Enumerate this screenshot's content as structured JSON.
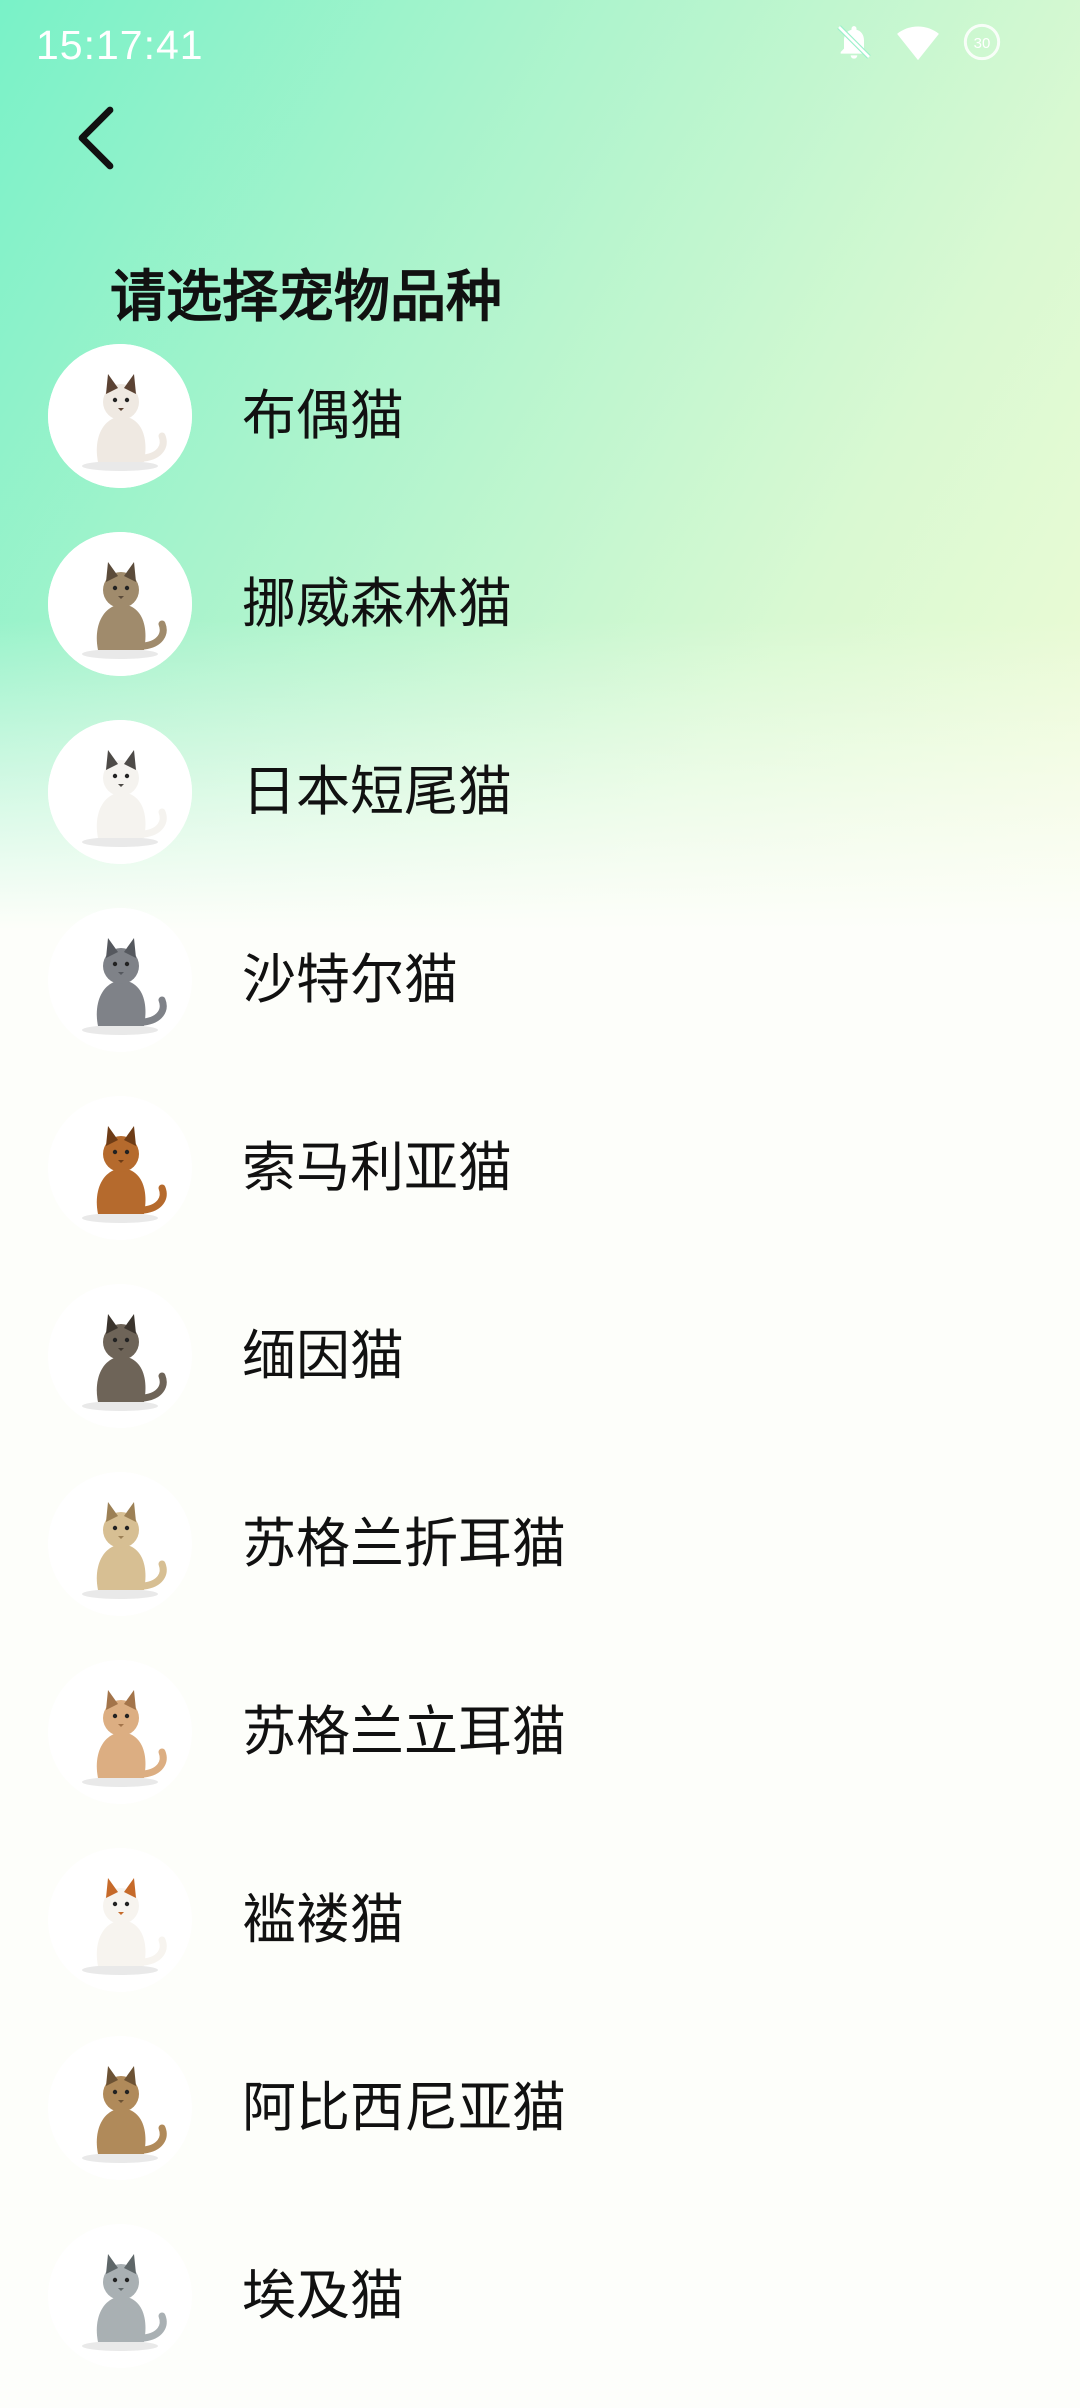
{
  "status_bar": {
    "time": "15:17:41",
    "icons": [
      "bell-off-icon",
      "wifi-icon",
      "data-saver-icon"
    ]
  },
  "header": {
    "back_icon": "chevron-left-icon",
    "title": "请选择宠物品种"
  },
  "breeds": [
    {
      "name": "布偶猫",
      "fur": "#efe9e2",
      "accent": "#5b4233"
    },
    {
      "name": "挪威森林猫",
      "fur": "#a08b6c",
      "accent": "#5b4b3a"
    },
    {
      "name": "日本短尾猫",
      "fur": "#f5f3ef",
      "accent": "#4d4a47"
    },
    {
      "name": "沙特尔猫",
      "fur": "#7f8288",
      "accent": "#55585e"
    },
    {
      "name": "索马利亚猫",
      "fur": "#b56a2d",
      "accent": "#6e3c16"
    },
    {
      "name": "缅因猫",
      "fur": "#6e6458",
      "accent": "#3b342d"
    },
    {
      "name": "苏格兰折耳猫",
      "fur": "#d7bf93",
      "accent": "#9c8055"
    },
    {
      "name": "苏格兰立耳猫",
      "fur": "#dcae82",
      "accent": "#a3744a"
    },
    {
      "name": "褴褛猫",
      "fur": "#f7f4ef",
      "accent": "#c66a2a"
    },
    {
      "name": "阿比西尼亚猫",
      "fur": "#b08a5a",
      "accent": "#6c5234"
    },
    {
      "name": "埃及猫",
      "fur": "#a9b0b3",
      "accent": "#5e6668"
    }
  ]
}
